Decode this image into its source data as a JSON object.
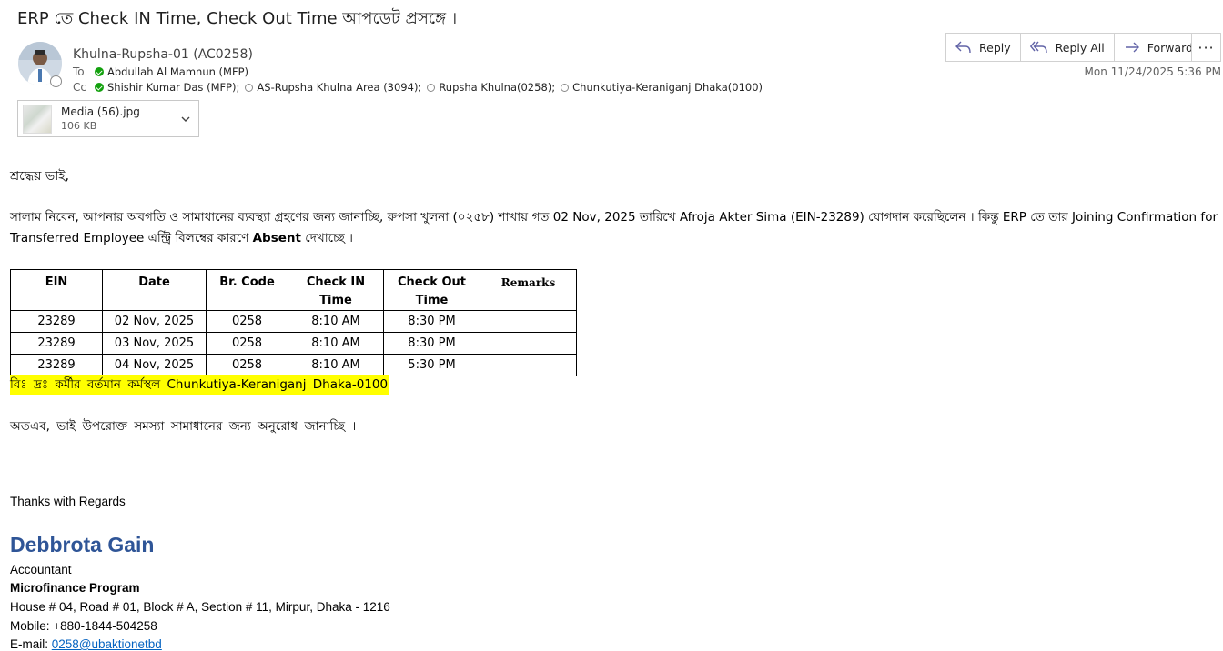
{
  "email": {
    "subject": "ERP তে  Check IN Time, Check Out Time আপডেট প্রসঙ্গে ।",
    "sender": "Khulna-Rupsha-01 (AC0258)",
    "to_label": "To",
    "cc_label": "Cc",
    "to": [
      {
        "name": "Abdullah Al Mamnun (MFP)",
        "status": "verified"
      }
    ],
    "cc": [
      {
        "name": "Shishir Kumar Das (MFP);",
        "status": "verified"
      },
      {
        "name": "AS-Rupsha Khulna Area (3094);",
        "status": "unknown"
      },
      {
        "name": "Rupsha Khulna(0258);",
        "status": "unknown"
      },
      {
        "name": "Chunkutiya-Keraniganj Dhaka(0100)",
        "status": "unknown"
      }
    ],
    "date": "Mon 11/24/2025 5:36 PM",
    "actions": {
      "reply": "Reply",
      "reply_all": "Reply All",
      "forward": "Forward",
      "more": "···"
    },
    "attachment": {
      "name": "Media (56).jpg",
      "size": "106 KB"
    }
  },
  "body": {
    "greeting": "শ্রদ্ধেয় ভাই,",
    "para_part1": "সালাম নিবেন, আপনার অবগতি ও সামাধানের ব্যবস্থ্যা গ্রহণের জন্য জানাচ্ছি, রুপসা খুলনা (০২৫৮) শাখায় গত 02 Nov, 2025 তারিখে Afroja Akter Sima (EIN-23289) যোগদান করেছিলেন । কিন্তু ERP তে তার Joining Confirmation for Transferred Employee এন্ট্রি বিলম্বের কারণে",
    "para_bold": "Absent",
    "para_part2": "দেখাচ্ছে ।",
    "table": {
      "headers": [
        "EIN",
        "Date",
        "Br. Code",
        "Check IN Time",
        "Check Out Time",
        "Remarks"
      ],
      "rows": [
        [
          "23289",
          "02 Nov, 2025",
          "0258",
          "8:10 AM",
          "8:30 PM",
          ""
        ],
        [
          "23289",
          "03 Nov, 2025",
          "0258",
          "8:10 AM",
          "8:30 PM",
          ""
        ],
        [
          "23289",
          "04 Nov, 2025",
          "0258",
          "8:10 AM",
          "5:30 PM",
          ""
        ]
      ]
    },
    "note": "বিঃ দ্রঃ কর্মীর বর্তমান কর্মস্থল Chunkutiya-Keraniganj Dhaka-0100",
    "request": "অতএব, ভাই উপরোক্ত সমস্যা সামাধানের জন্য অনুরোধ জানাচ্ছি ।",
    "thanks": "Thanks with Regards"
  },
  "signature": {
    "name": "Debbrota Gain",
    "title": "Accountant",
    "org": "Microfinance Program",
    "address": "House # 04, Road # 01, Block # A, Section # 11, Mirpur, Dhaka - 1216",
    "mobile": "Mobile: +880-1844-504258",
    "email_label": "E-mail: ",
    "email": "0258@ubaktionetbd"
  },
  "colors": {
    "highlight": "#ffff00",
    "signature_name": "#2f5597",
    "verified": "#13a10e",
    "link": "#0563c1"
  }
}
